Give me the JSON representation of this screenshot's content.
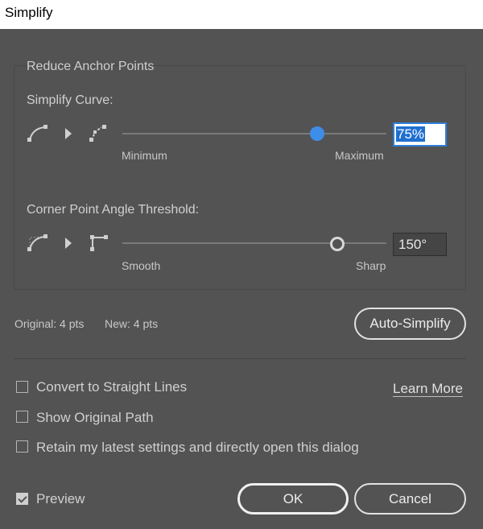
{
  "window": {
    "title": "Simplify"
  },
  "group": {
    "title": "Reduce Anchor Points"
  },
  "simplify_curve": {
    "label": "Simplify Curve:",
    "min_label": "Minimum",
    "max_label": "Maximum",
    "value_text": "75%",
    "value_fraction": 0.75
  },
  "corner_angle": {
    "label": "Corner Point Angle Threshold:",
    "min_label": "Smooth",
    "max_label": "Sharp",
    "value_text": "150°",
    "value_fraction": 0.83
  },
  "stats": {
    "original": "Original: 4 pts",
    "new": "New: 4 pts"
  },
  "buttons": {
    "auto_simplify": "Auto-Simplify",
    "ok": "OK",
    "cancel": "Cancel"
  },
  "options": {
    "convert_straight": {
      "label": "Convert to Straight Lines",
      "checked": false
    },
    "show_original": {
      "label": "Show Original Path",
      "checked": false
    },
    "retain_settings": {
      "label": "Retain my latest settings and directly open this dialog",
      "checked": false
    },
    "preview": {
      "label": "Preview",
      "checked": true
    }
  },
  "learn_more": "Learn More",
  "colors": {
    "background": "#535353",
    "accent": "#3d8ee8",
    "text": "#d6d6d6"
  }
}
